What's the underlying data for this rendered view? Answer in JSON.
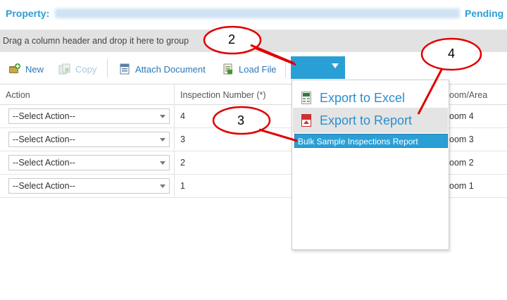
{
  "header": {
    "property_label": "Property:",
    "status": "Pending"
  },
  "group_bar": {
    "text": "Drag a column header and drop it here to group"
  },
  "toolbar": {
    "new_label": "New",
    "copy_label": "Copy",
    "attach_label": "Attach Document",
    "load_label": "Load File"
  },
  "grid": {
    "columns": [
      "Action",
      "Inspection Number (*)",
      "oom/Area"
    ],
    "rows": [
      {
        "action": "--Select Action--",
        "number": "4",
        "room": "oom 4"
      },
      {
        "action": "--Select Action--",
        "number": "3",
        "room": "oom 3"
      },
      {
        "action": "--Select Action--",
        "number": "2",
        "room": "oom 2"
      },
      {
        "action": "--Select Action--",
        "number": "1",
        "room": "oom 1"
      }
    ]
  },
  "export_menu": {
    "excel_label": "Export to Excel",
    "report_label": "Export to Report",
    "bulk_label": "Bulk Sample Inspections Report"
  },
  "callouts": {
    "c2": "2",
    "c3": "3",
    "c4": "4"
  },
  "colors": {
    "accent": "#2a9fd6",
    "link": "#2a78b8",
    "callout_border": "#e00000"
  },
  "icons": {
    "new": "add-document-icon",
    "copy": "copy-icon",
    "attach": "attach-document-icon",
    "load": "load-file-icon",
    "excel": "excel-icon",
    "pdf": "pdf-icon"
  }
}
